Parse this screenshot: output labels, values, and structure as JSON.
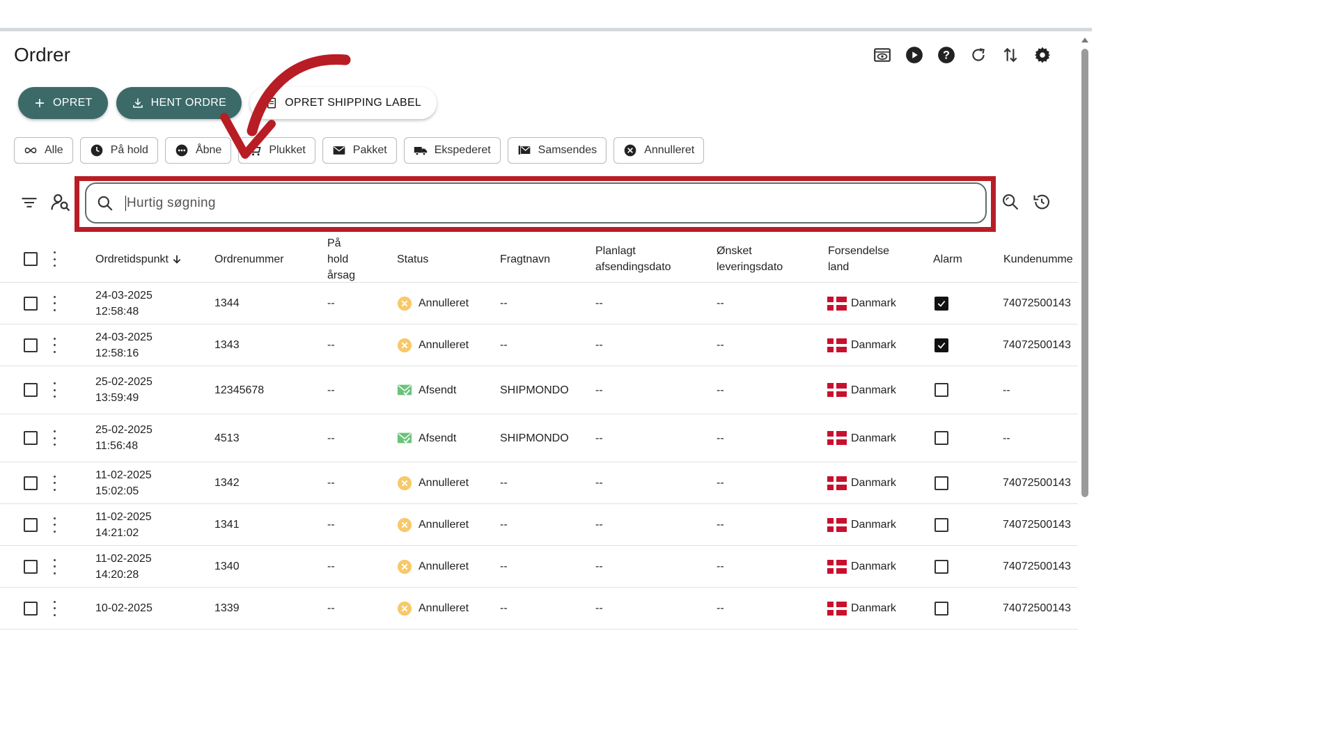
{
  "page": {
    "title": "Ordrer"
  },
  "header_icons": [
    "preview-icon",
    "play-icon",
    "help-icon",
    "refresh-icon",
    "sort-arrows-icon",
    "settings-gear-icon"
  ],
  "actions": {
    "create": "OPRET",
    "fetch_orders": "HENT ORDRE",
    "create_shipping_label": "OPRET SHIPPING LABEL"
  },
  "filters": [
    {
      "label": "Alle",
      "icon": "infinity-icon"
    },
    {
      "label": "På hold",
      "icon": "clock-icon"
    },
    {
      "label": "Åbne",
      "icon": "dots-circle-icon"
    },
    {
      "label": "Plukket",
      "icon": "cart-icon"
    },
    {
      "label": "Pakket",
      "icon": "envelope-icon"
    },
    {
      "label": "Ekspederet",
      "icon": "truck-icon"
    },
    {
      "label": "Samsendes",
      "icon": "mail-stack-icon"
    },
    {
      "label": "Annulleret",
      "icon": "cancel-circle-icon"
    }
  ],
  "search": {
    "placeholder": "Hurtig søgning"
  },
  "table": {
    "columns": {
      "order_time": "Ordretidspunkt",
      "order_number": "Ordrenummer",
      "hold_reason": [
        "På",
        "hold",
        "årsag"
      ],
      "status": "Status",
      "carrier": "Fragtnavn",
      "planned_ship": [
        "Planlagt",
        "afsendingsdato"
      ],
      "desired_delivery": [
        "Ønsket",
        "leveringsdato"
      ],
      "ship_country": [
        "Forsendelse",
        "land"
      ],
      "alarm": "Alarm",
      "customer_number": "Kundenumme"
    },
    "rows": [
      {
        "date": "24-03-2025",
        "time": "12:58:48",
        "order": "1344",
        "hold": "--",
        "status": "Annulleret",
        "status_type": "cancelled",
        "carrier": "--",
        "planned": "--",
        "desired": "--",
        "country": "Danmark",
        "alarm": true,
        "customer": "74072500143"
      },
      {
        "date": "24-03-2025",
        "time": "12:58:16",
        "order": "1343",
        "hold": "--",
        "status": "Annulleret",
        "status_type": "cancelled",
        "carrier": "--",
        "planned": "--",
        "desired": "--",
        "country": "Danmark",
        "alarm": true,
        "customer": "74072500143"
      },
      {
        "date": "25-02-2025",
        "time": "13:59:49",
        "order": "12345678",
        "hold": "--",
        "status": "Afsendt",
        "status_type": "sent",
        "carrier": "SHIPMONDO",
        "planned": "--",
        "desired": "--",
        "country": "Danmark",
        "alarm": false,
        "customer": "--"
      },
      {
        "date": "25-02-2025",
        "time": "11:56:48",
        "order": "4513",
        "hold": "--",
        "status": "Afsendt",
        "status_type": "sent",
        "carrier": "SHIPMONDO",
        "planned": "--",
        "desired": "--",
        "country": "Danmark",
        "alarm": false,
        "customer": "--"
      },
      {
        "date": "11-02-2025",
        "time": "15:02:05",
        "order": "1342",
        "hold": "--",
        "status": "Annulleret",
        "status_type": "cancelled",
        "carrier": "--",
        "planned": "--",
        "desired": "--",
        "country": "Danmark",
        "alarm": false,
        "customer": "74072500143"
      },
      {
        "date": "11-02-2025",
        "time": "14:21:02",
        "order": "1341",
        "hold": "--",
        "status": "Annulleret",
        "status_type": "cancelled",
        "carrier": "--",
        "planned": "--",
        "desired": "--",
        "country": "Danmark",
        "alarm": false,
        "customer": "74072500143"
      },
      {
        "date": "11-02-2025",
        "time": "14:20:28",
        "order": "1340",
        "hold": "--",
        "status": "Annulleret",
        "status_type": "cancelled",
        "carrier": "--",
        "planned": "--",
        "desired": "--",
        "country": "Danmark",
        "alarm": false,
        "customer": "74072500143"
      },
      {
        "date": "10-02-2025",
        "time": "",
        "order": "1339",
        "hold": "--",
        "status": "Annulleret",
        "status_type": "cancelled",
        "carrier": "--",
        "planned": "--",
        "desired": "--",
        "country": "Danmark",
        "alarm": false,
        "customer": "74072500143"
      }
    ]
  },
  "colors": {
    "primary_button": "#3b6a69",
    "highlight": "#b81d25",
    "cancelled": "#f7c96a",
    "sent": "#6ac37a",
    "flag_red": "#c8102e"
  }
}
